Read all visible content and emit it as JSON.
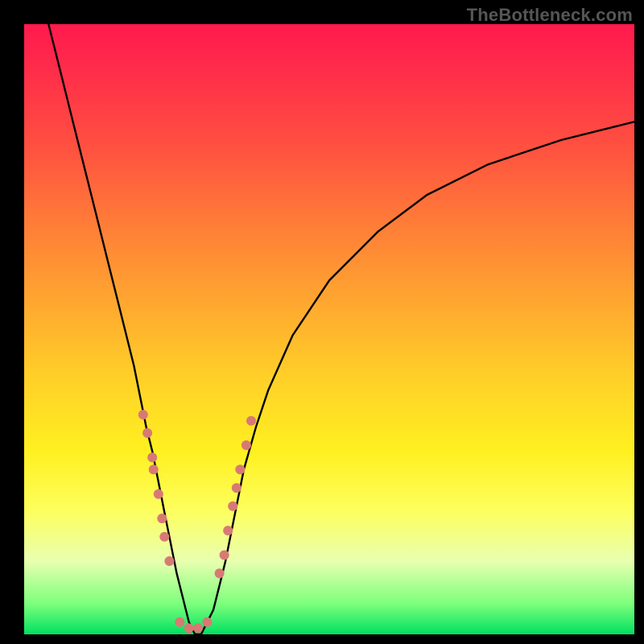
{
  "watermark": "TheBottleneck.com",
  "chart_data": {
    "type": "line",
    "title": "",
    "xlabel": "",
    "ylabel": "",
    "xlim": [
      0,
      100
    ],
    "ylim": [
      0,
      100
    ],
    "background_gradient": {
      "top_color": "#ff1a4d",
      "bottom_color": "#00e060",
      "meaning": "red = high bottleneck, green = low bottleneck"
    },
    "series": [
      {
        "name": "bottleneck-curve",
        "description": "V-shaped bottleneck curve; minimum near x≈28 at y≈0",
        "x": [
          4,
          6,
          8,
          10,
          12,
          14,
          16,
          18,
          20,
          21,
          22,
          23,
          24,
          25,
          26,
          27,
          28,
          29,
          30,
          31,
          32,
          33,
          34,
          35,
          36,
          38,
          40,
          44,
          50,
          58,
          66,
          76,
          88,
          100
        ],
        "y": [
          100,
          92,
          84,
          76,
          68,
          60,
          52,
          44,
          34,
          30,
          25,
          20,
          15,
          10,
          6,
          2,
          0,
          0,
          2,
          4,
          8,
          12,
          17,
          22,
          27,
          34,
          40,
          49,
          58,
          66,
          72,
          77,
          81,
          84
        ]
      }
    ],
    "markers": [
      {
        "name": "left-branch-dots",
        "x_approx": [
          19.5,
          20.2,
          21.0,
          21.2,
          22.0,
          22.6,
          23.0,
          23.8
        ],
        "y_approx": [
          36,
          33,
          29,
          27,
          23,
          19,
          16,
          12
        ],
        "color": "#d87a74",
        "size": 12
      },
      {
        "name": "bottom-dots",
        "x_approx": [
          25.5,
          27.0,
          28.5,
          30.0
        ],
        "y_approx": [
          2,
          1,
          1,
          2
        ],
        "color": "#d87a74",
        "size": 12
      },
      {
        "name": "right-branch-dots",
        "x_approx": [
          32.0,
          32.8,
          33.4,
          34.2,
          34.8,
          35.4,
          36.4,
          37.2
        ],
        "y_approx": [
          10,
          13,
          17,
          21,
          24,
          27,
          31,
          35
        ],
        "color": "#d87a74",
        "size": 12
      }
    ]
  }
}
